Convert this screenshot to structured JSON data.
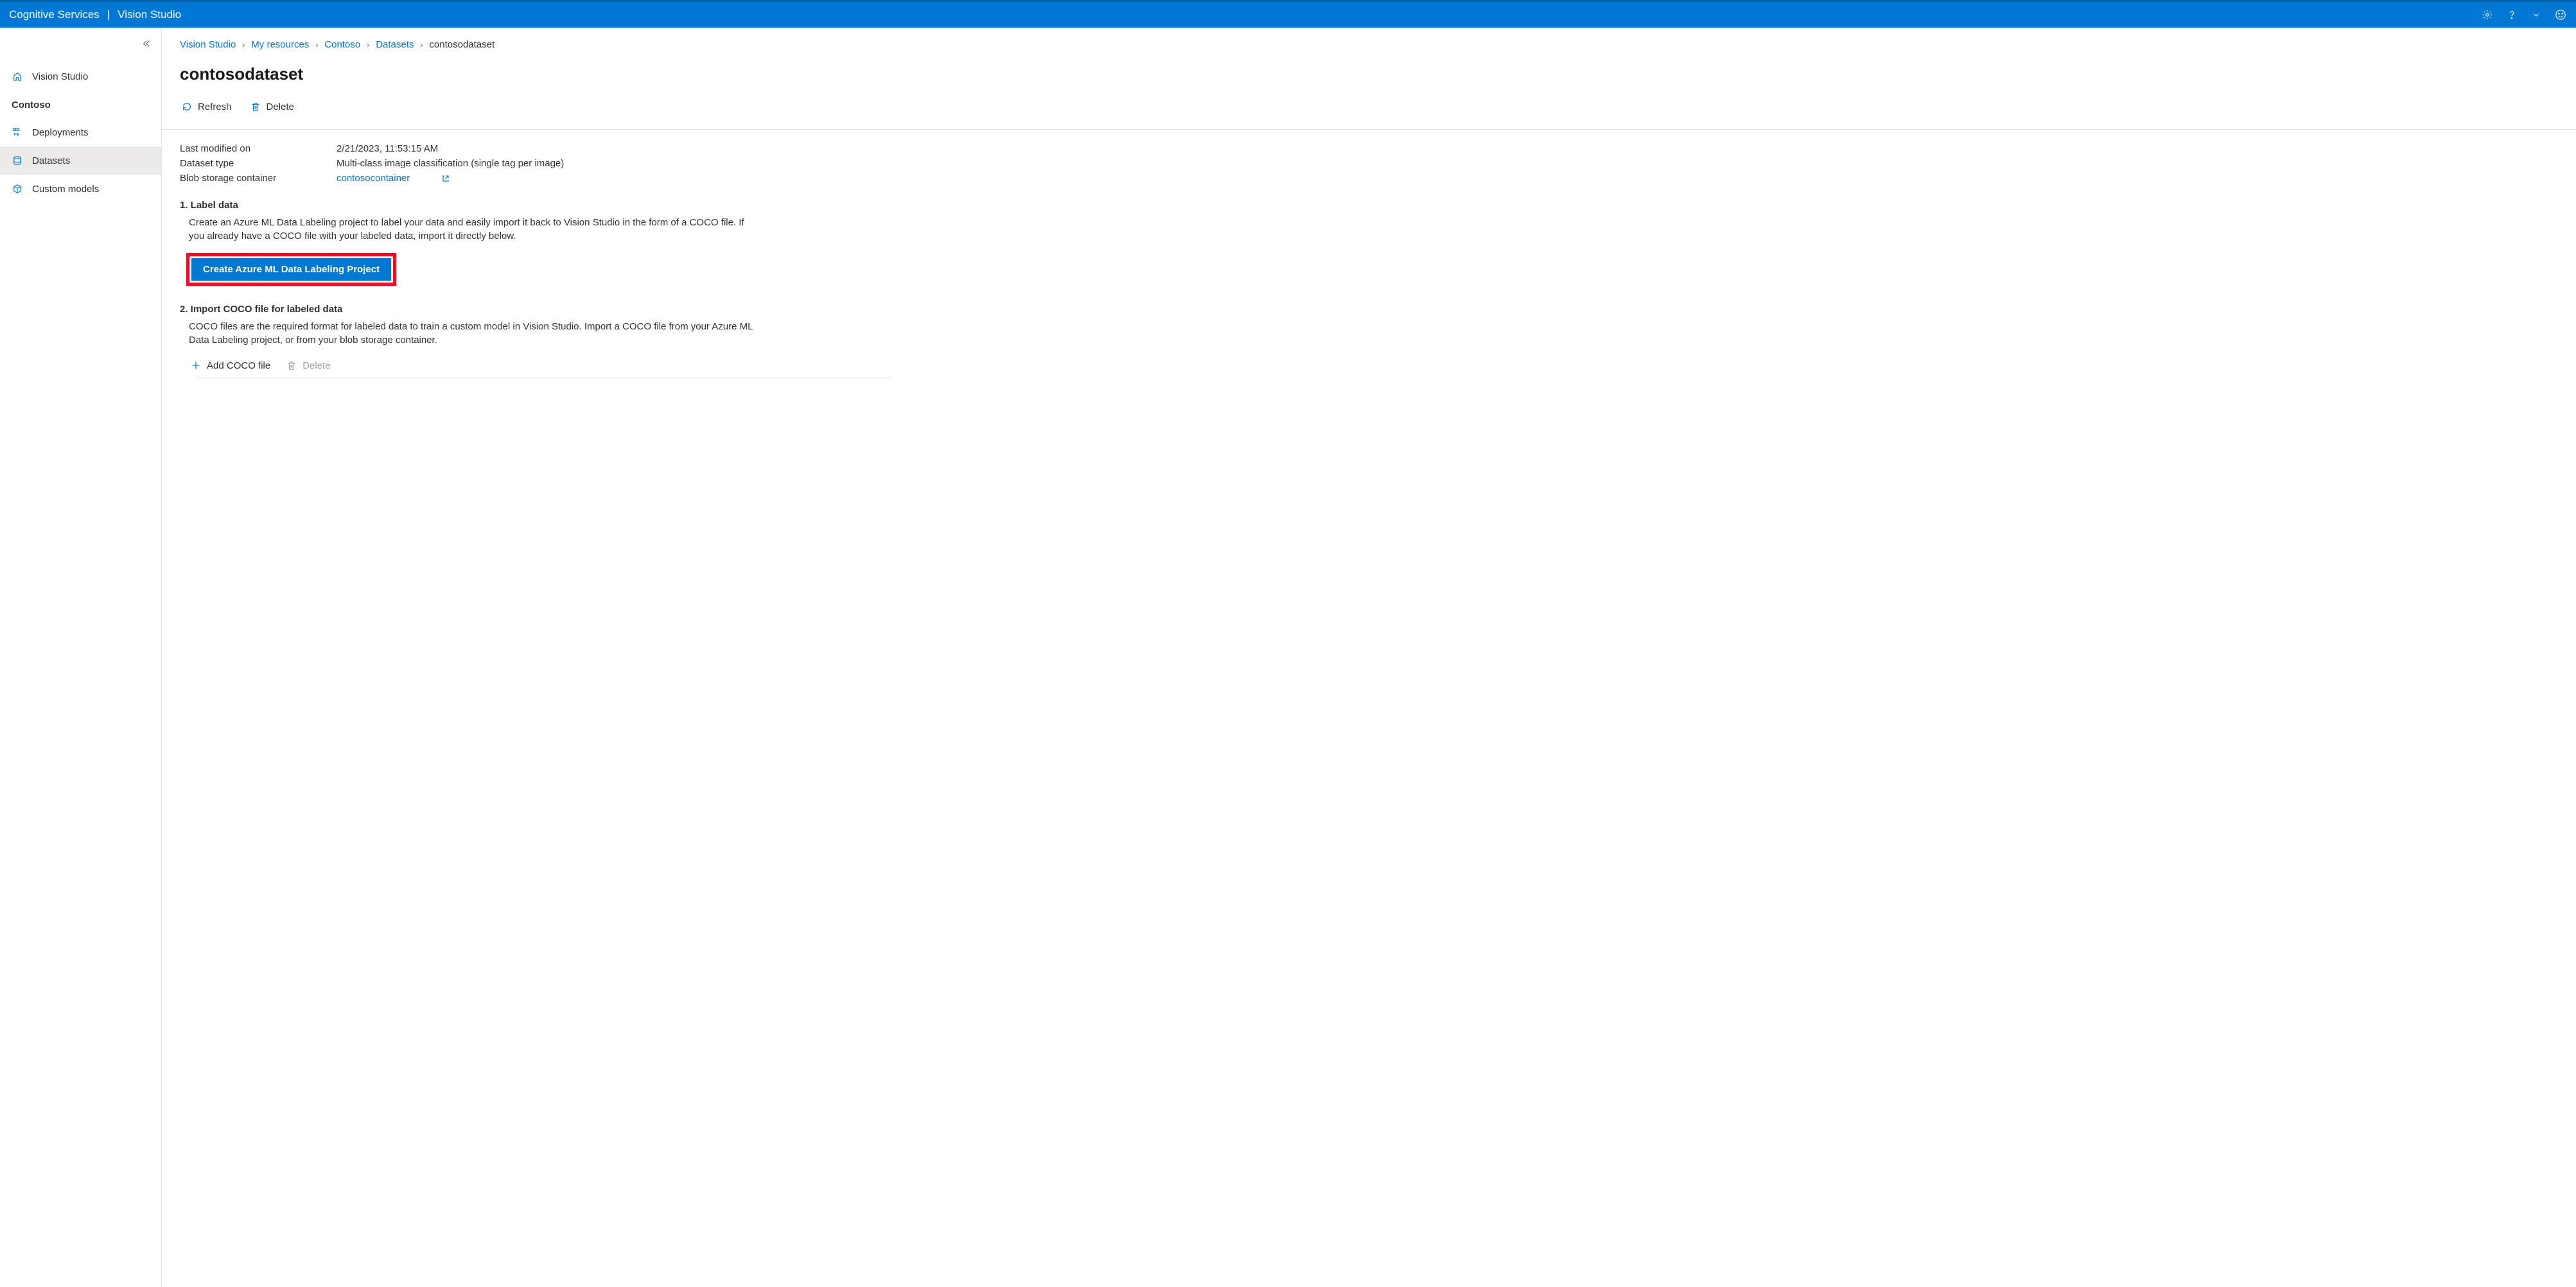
{
  "header": {
    "service": "Cognitive Services",
    "app": "Vision Studio"
  },
  "sidebar": {
    "home_label": "Vision Studio",
    "resource_label": "Contoso",
    "items": [
      {
        "label": "Deployments"
      },
      {
        "label": "Datasets"
      },
      {
        "label": "Custom models"
      }
    ]
  },
  "breadcrumb": [
    {
      "label": "Vision Studio",
      "link": true
    },
    {
      "label": "My resources",
      "link": true
    },
    {
      "label": "Contoso",
      "link": true
    },
    {
      "label": "Datasets",
      "link": true
    },
    {
      "label": "contosodataset",
      "link": false
    }
  ],
  "page_title": "contosodataset",
  "toolbar": {
    "refresh_label": "Refresh",
    "delete_label": "Delete"
  },
  "meta": {
    "last_modified_label": "Last modified on",
    "last_modified_value": "2/21/2023, 11:53:15 AM",
    "dataset_type_label": "Dataset type",
    "dataset_type_value": "Multi-class image classification (single tag per image)",
    "container_label": "Blob storage container",
    "container_value": "contosocontainer"
  },
  "section1": {
    "heading": "1. Label data",
    "desc": "Create an Azure ML Data Labeling project to label your data and easily import it back to Vision Studio in the form of a COCO file. If you already have a COCO file with your labeled data, import it directly below.",
    "button": "Create Azure ML Data Labeling Project"
  },
  "section2": {
    "heading": "2. Import COCO file for labeled data",
    "desc": "COCO files are the required format for labeled data to train a custom model in Vision Studio. Import a COCO file from your Azure ML Data Labeling project, or from your blob storage container.",
    "add_label": "Add COCO file",
    "delete_label": "Delete"
  }
}
